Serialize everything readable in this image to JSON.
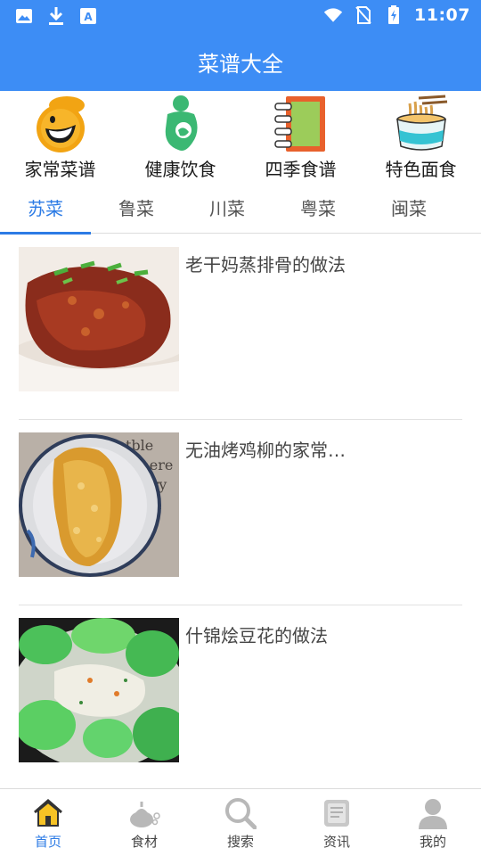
{
  "status_bar": {
    "time": "11:07",
    "icons": [
      "image-icon",
      "download-icon",
      "translate-icon",
      "wifi-icon",
      "no-sim-icon",
      "battery-charging-icon"
    ]
  },
  "header": {
    "title": "菜谱大全"
  },
  "categories": [
    {
      "label": "家常菜谱",
      "icon": "chef-face-icon"
    },
    {
      "label": "健康饮食",
      "icon": "mother-child-icon"
    },
    {
      "label": "四季食谱",
      "icon": "notebook-icon"
    },
    {
      "label": "特色面食",
      "icon": "noodle-bowl-icon"
    }
  ],
  "tabs": [
    {
      "label": "苏菜",
      "active": true
    },
    {
      "label": "鲁菜",
      "active": false
    },
    {
      "label": "川菜",
      "active": false
    },
    {
      "label": "粤菜",
      "active": false
    },
    {
      "label": "闽菜",
      "active": false
    }
  ],
  "recipes": [
    {
      "title": "老干妈蒸排骨的做法"
    },
    {
      "title": "无油烤鸡柳的家常…"
    },
    {
      "title": "什锦烩豆花的做法"
    }
  ],
  "bottom_nav": [
    {
      "label": "首页",
      "icon": "home-icon",
      "active": true
    },
    {
      "label": "食材",
      "icon": "ingredients-icon",
      "active": false
    },
    {
      "label": "搜索",
      "icon": "search-icon",
      "active": false
    },
    {
      "label": "资讯",
      "icon": "news-icon",
      "active": false
    },
    {
      "label": "我的",
      "icon": "profile-icon",
      "active": false
    }
  ],
  "colors": {
    "primary": "#3d8df5",
    "tab_active": "#2c7be5",
    "icon_gray": "#b8b8b8"
  }
}
